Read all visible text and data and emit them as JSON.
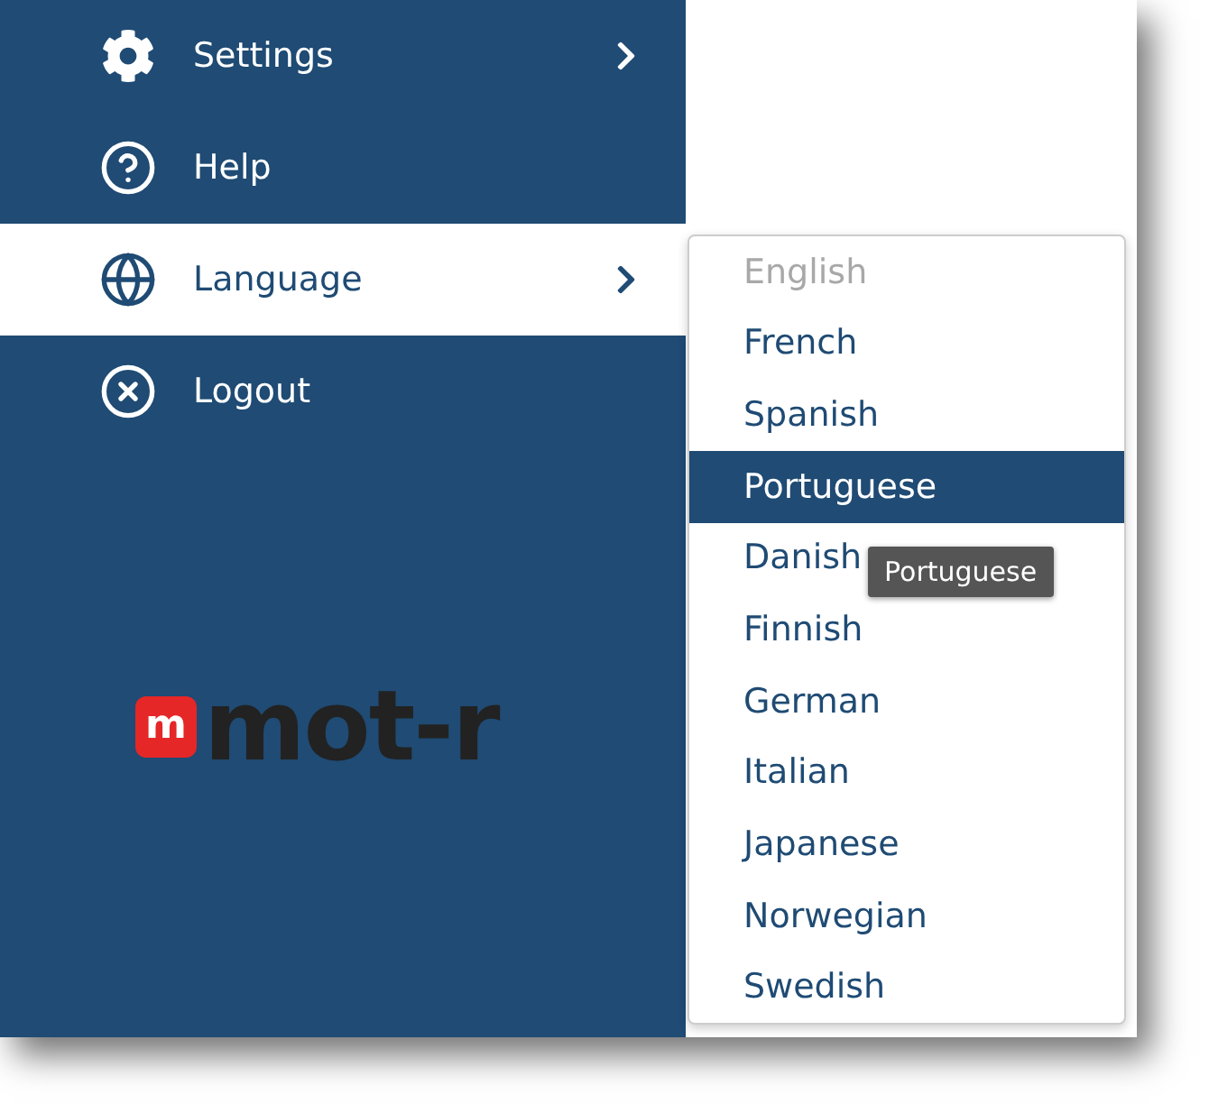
{
  "menu": [
    {
      "label": "Settings",
      "kind": "gear",
      "selected": false,
      "has_submenu": true
    },
    {
      "label": "Help",
      "kind": "help",
      "selected": false,
      "has_submenu": false
    },
    {
      "label": "Language",
      "kind": "globe",
      "selected": true,
      "has_submenu": true
    },
    {
      "label": "Logout",
      "kind": "close",
      "selected": false,
      "has_submenu": false
    }
  ],
  "logo": {
    "badge": "m",
    "text": "mot-r"
  },
  "languages": [
    {
      "label": "English",
      "disabled": true,
      "selected": false
    },
    {
      "label": "French",
      "disabled": false,
      "selected": false
    },
    {
      "label": "Spanish",
      "disabled": false,
      "selected": false
    },
    {
      "label": "Portuguese",
      "disabled": false,
      "selected": true
    },
    {
      "label": "Danish",
      "disabled": false,
      "selected": false
    },
    {
      "label": "Finnish",
      "disabled": false,
      "selected": false
    },
    {
      "label": "German",
      "disabled": false,
      "selected": false
    },
    {
      "label": "Italian",
      "disabled": false,
      "selected": false
    },
    {
      "label": "Japanese",
      "disabled": false,
      "selected": false
    },
    {
      "label": "Norwegian",
      "disabled": false,
      "selected": false
    },
    {
      "label": "Swedish",
      "disabled": false,
      "selected": false
    }
  ],
  "tooltip": "Portuguese"
}
